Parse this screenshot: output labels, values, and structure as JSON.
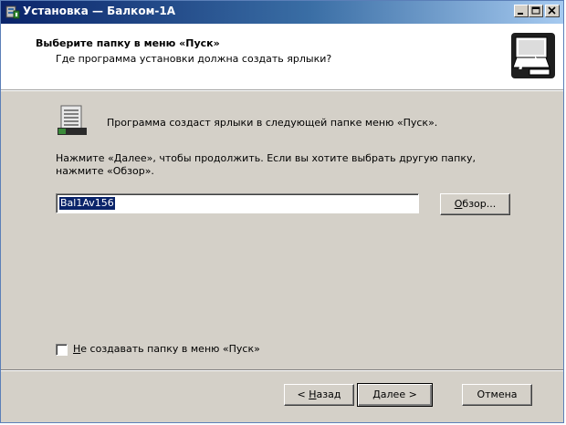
{
  "window": {
    "title": "Установка — Балком-1А",
    "icon": "installer-icon"
  },
  "header": {
    "title": "Выберите папку в меню «Пуск»",
    "subtitle": "Где программа установки должна создать ярлыки?",
    "graphic": "computer-install-graphic"
  },
  "body": {
    "info_text": "Программа создаст ярлыки в следующей папке меню «Пуск».",
    "instruction": "Нажмите «Далее», чтобы продолжить. Если вы хотите выбрать другую папку, нажмите «Обзор».",
    "folder_value": "Bal1Av156",
    "browse_label_ul": "О",
    "browse_label_rest": "бзор...",
    "checkbox_label_ul": "Н",
    "checkbox_label_rest": "е создавать папку в меню «Пуск»",
    "checkbox_checked": false
  },
  "footer": {
    "back_prefix": "< ",
    "back_ul": "Н",
    "back_rest": "азад",
    "next_ul": "Д",
    "next_rest": "алее >",
    "cancel_label": "Отмена"
  }
}
